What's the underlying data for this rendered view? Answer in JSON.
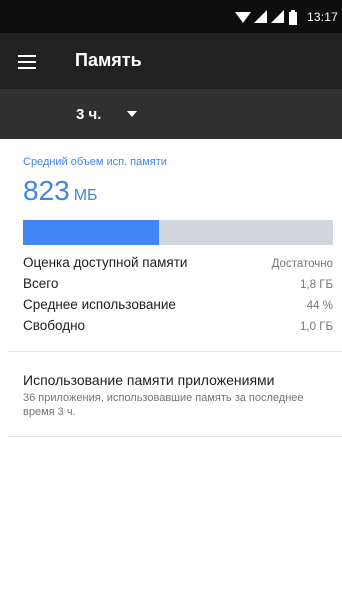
{
  "status_bar": {
    "time": "13:17",
    "icons": [
      "wifi-icon",
      "signal-icon",
      "signal-icon",
      "battery-icon"
    ]
  },
  "app_bar": {
    "menu_icon": "menu-icon",
    "title": "Память"
  },
  "period_selector": {
    "selected": "3 ч.",
    "icon": "dropdown-arrow-icon"
  },
  "summary": {
    "avg_label": "Средний объем исп. памяти",
    "avg_value": "823",
    "avg_unit": "МБ",
    "usage_fraction": 0.44,
    "stats": [
      {
        "label": "Оценка доступной памяти",
        "value": "Достаточно"
      },
      {
        "label": "Всего",
        "value": "1,8 ГБ"
      },
      {
        "label": "Среднее использование",
        "value": "44 %"
      },
      {
        "label": "Свободно",
        "value": "1,0 ГБ"
      }
    ]
  },
  "apps_memory": {
    "title": "Использование памяти приложениями",
    "description": "36 приложения, использовавшие память за последнее время 3 ч."
  },
  "colors": {
    "accent": "#4184e6",
    "progress_fill": "#4285f4",
    "progress_track": "#d0d8de",
    "app_bar": "#212121",
    "sub_bar": "#303030",
    "status_bar": "#0d0d0d"
  }
}
